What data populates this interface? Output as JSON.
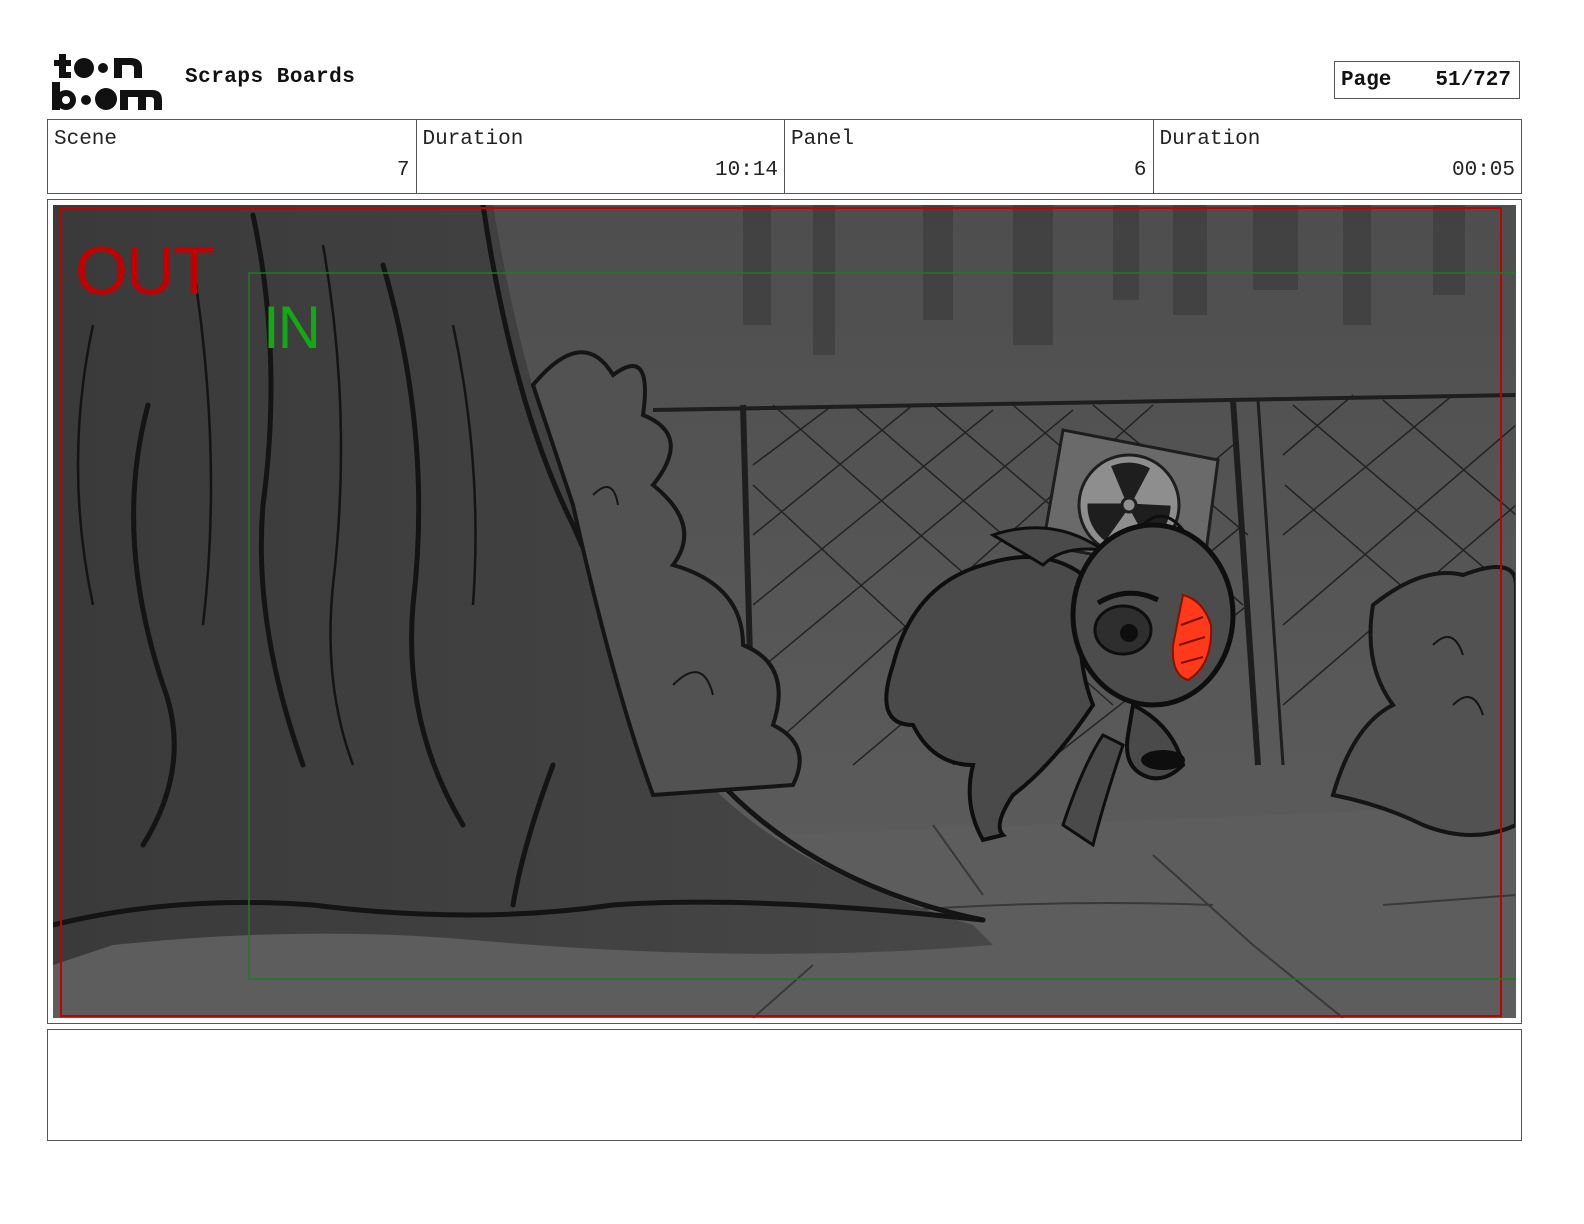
{
  "header": {
    "logo_text": "toonboom",
    "app_title": "Scraps Boards",
    "page_label": "Page",
    "page_value": "51/727"
  },
  "info": {
    "scene_label": "Scene",
    "scene_value": "7",
    "scene_duration_label": "Duration",
    "scene_duration_value": "10:14",
    "panel_label": "Panel",
    "panel_value": "6",
    "panel_duration_label": "Duration",
    "panel_duration_value": "00:05"
  },
  "panel": {
    "out_label": "OUT",
    "in_label": "IN",
    "out_frame_color": "#c20000",
    "in_frame_color": "#1f7a1f",
    "highlight_color": "#ff3a1a"
  },
  "notes": {
    "text": ""
  }
}
